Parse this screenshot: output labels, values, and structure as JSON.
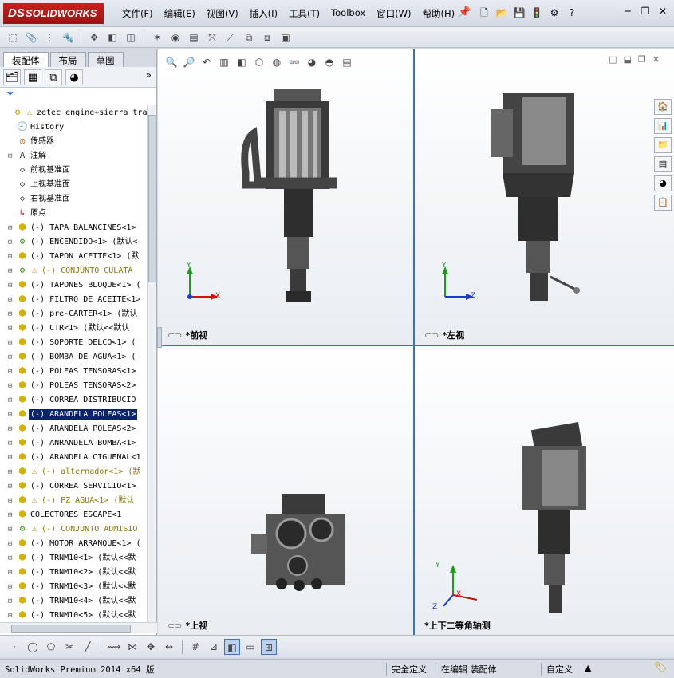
{
  "app": {
    "brand": "SOLIDWORKS",
    "brand_ds": "DS",
    "menu": [
      "文件(F)",
      "编辑(E)",
      "视图(V)",
      "插入(I)",
      "工具(T)",
      "Toolbox",
      "窗口(W)",
      "帮助(H)"
    ]
  },
  "tabs": [
    "装配体",
    "布局",
    "草图"
  ],
  "tree": [
    {
      "label": "zetec engine+sierra tra",
      "icon": "assembly-icon",
      "warn": true,
      "expand": "",
      "indent": 0
    },
    {
      "label": "History",
      "icon": "history-icon",
      "warn": false,
      "expand": "",
      "indent": 1
    },
    {
      "label": "传感器",
      "icon": "sensor-icon",
      "warn": false,
      "expand": "",
      "indent": 1
    },
    {
      "label": "注解",
      "icon": "annotation-icon",
      "warn": false,
      "expand": "+",
      "indent": 1
    },
    {
      "label": "前视基准面",
      "icon": "plane-icon",
      "warn": false,
      "expand": "",
      "indent": 1
    },
    {
      "label": "上视基准面",
      "icon": "plane-icon",
      "warn": false,
      "expand": "",
      "indent": 1
    },
    {
      "label": "右视基准面",
      "icon": "plane-icon",
      "warn": false,
      "expand": "",
      "indent": 1
    },
    {
      "label": "原点",
      "icon": "origin-icon",
      "warn": false,
      "expand": "",
      "indent": 1
    },
    {
      "label": "(-) TAPA BALANCINES<1>",
      "icon": "part-icon",
      "warn": false,
      "expand": "+",
      "indent": 1
    },
    {
      "label": "(-) ENCENDIDO<1> (默认<",
      "icon": "subassembly-icon",
      "warn": false,
      "expand": "+",
      "indent": 1
    },
    {
      "label": "(-) TAPON ACEITE<1> (默",
      "icon": "part-icon",
      "warn": false,
      "expand": "+",
      "indent": 1
    },
    {
      "label": "(-) CONJUNTO CULATA",
      "icon": "subassembly-icon",
      "warn": true,
      "expand": "+",
      "indent": 1,
      "yellow": true
    },
    {
      "label": "(-) TAPONES BLOQUE<1> (",
      "icon": "part-icon",
      "warn": false,
      "expand": "+",
      "indent": 1
    },
    {
      "label": "(-) FILTRO DE ACEITE<1>",
      "icon": "part-icon",
      "warn": false,
      "expand": "+",
      "indent": 1
    },
    {
      "label": "(-) pre-CARTER<1> (默认",
      "icon": "part-icon",
      "warn": false,
      "expand": "+",
      "indent": 1
    },
    {
      "label": "(-) CTR<1> (默认<<默认",
      "icon": "part-icon",
      "warn": false,
      "expand": "+",
      "indent": 1
    },
    {
      "label": "(-) SOPORTE DELCO<1> (",
      "icon": "part-icon",
      "warn": false,
      "expand": "+",
      "indent": 1
    },
    {
      "label": "(-) BOMBA DE AGUA<1> (",
      "icon": "part-icon",
      "warn": false,
      "expand": "+",
      "indent": 1
    },
    {
      "label": "(-) POLEAS TENSORAS<1>",
      "icon": "part-icon",
      "warn": false,
      "expand": "+",
      "indent": 1
    },
    {
      "label": "(-) POLEAS TENSORAS<2>",
      "icon": "part-icon",
      "warn": false,
      "expand": "+",
      "indent": 1
    },
    {
      "label": "(-) CORREA DISTRIBUCIO",
      "icon": "part-icon",
      "warn": false,
      "expand": "+",
      "indent": 1
    },
    {
      "label": "(-) ARANDELA POLEAS<1>",
      "icon": "part-icon",
      "warn": false,
      "expand": "+",
      "indent": 1,
      "selected": true
    },
    {
      "label": "(-) ARANDELA POLEAS<2>",
      "icon": "part-icon",
      "warn": false,
      "expand": "+",
      "indent": 1
    },
    {
      "label": "(-) ANRANDELA BOMBA<1>",
      "icon": "part-icon",
      "warn": false,
      "expand": "+",
      "indent": 1
    },
    {
      "label": "(-) ARANDELA CIGUENAL<1",
      "icon": "part-icon",
      "warn": false,
      "expand": "+",
      "indent": 1
    },
    {
      "label": "(-) alternador<1> (默",
      "icon": "part-icon",
      "warn": true,
      "expand": "+",
      "indent": 1,
      "yellow": true
    },
    {
      "label": "(-) CORREA SERVICIO<1>",
      "icon": "part-icon",
      "warn": false,
      "expand": "+",
      "indent": 1
    },
    {
      "label": "(-) PZ AGUA<1> (默认",
      "icon": "part-icon",
      "warn": true,
      "expand": "+",
      "indent": 1,
      "yellow": true
    },
    {
      "label": "COLECTORES ESCAPE<1",
      "icon": "part-icon",
      "warn": false,
      "expand": "+",
      "indent": 1
    },
    {
      "label": "(-) CONJUNTO ADMISIO",
      "icon": "subassembly-icon",
      "warn": true,
      "expand": "+",
      "indent": 1,
      "yellow": true
    },
    {
      "label": "(-) MOTOR ARRANQUE<1> (",
      "icon": "part-icon",
      "warn": false,
      "expand": "+",
      "indent": 1
    },
    {
      "label": "(-) TRNM10<1> (默认<<默",
      "icon": "part-icon",
      "warn": false,
      "expand": "+",
      "indent": 1
    },
    {
      "label": "(-) TRNM10<2> (默认<<默",
      "icon": "part-icon",
      "warn": false,
      "expand": "+",
      "indent": 1
    },
    {
      "label": "(-) TRNM10<3> (默认<<默",
      "icon": "part-icon",
      "warn": false,
      "expand": "+",
      "indent": 1
    },
    {
      "label": "(-) TRNM10<4> (默认<<默",
      "icon": "part-icon",
      "warn": false,
      "expand": "+",
      "indent": 1
    },
    {
      "label": "(-) TRNM10<5> (默认<<默",
      "icon": "part-icon",
      "warn": false,
      "expand": "+",
      "indent": 1
    }
  ],
  "viewports": {
    "front": "*前视",
    "left": "*左视",
    "top": "*上视",
    "iso": "*上下二等角轴测"
  },
  "axes": {
    "x": "X",
    "y": "Y",
    "z": "Z"
  },
  "status": {
    "app": "SolidWorks Premium 2014 x64 版",
    "defined": "完全定义",
    "editing": "在编辑 装配体",
    "custom": "自定义",
    "arrow": "▲"
  },
  "colors": {
    "accent": "#0a246a",
    "divider": "#3f6fb5",
    "brand": "#c8201e"
  }
}
